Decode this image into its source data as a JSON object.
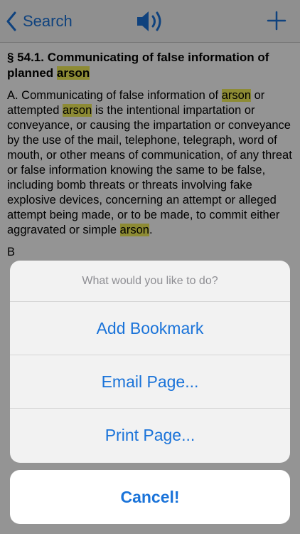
{
  "navbar": {
    "back_label": "Search",
    "speaker_icon": "speaker-icon",
    "add_icon": "plus-icon"
  },
  "document": {
    "title_prefix": "§ 54.1. Communicating of false information of planned ",
    "title_highlight": "arson",
    "para1": [
      {
        "text": "A. Communicating of false information of ",
        "hl": false
      },
      {
        "text": "arson",
        "hl": true
      },
      {
        "text": " or attempted ",
        "hl": false
      },
      {
        "text": "arson",
        "hl": true
      },
      {
        "text": " is the intentional impartation or conveyance, or causing the impartation or conveyance by the use of the mail, telephone, telegraph, word of mouth, or other means of communication, of any threat or false information knowing the same to be false, including bomb threats or threats involving fake explosive devices, concerning an attempt or alleged attempt being made, or to be made, to commit either aggravated or simple ",
        "hl": false
      },
      {
        "text": "arson",
        "hl": true
      },
      {
        "text": ".",
        "hl": false
      }
    ],
    "para2_partial": "B"
  },
  "action_sheet": {
    "prompt": "What would you like to do?",
    "buttons": [
      "Add Bookmark",
      "Email Page...",
      "Print Page..."
    ],
    "cancel": "Cancel!"
  },
  "colors": {
    "accent": "#1a73d9",
    "highlight": "#f3f05a"
  }
}
